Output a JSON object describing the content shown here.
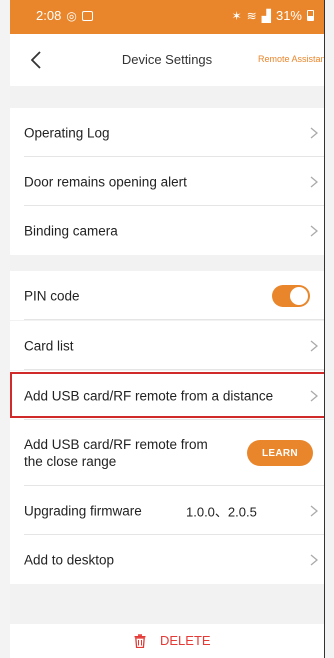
{
  "status_bar": {
    "time": "2:08",
    "battery": "31%"
  },
  "header": {
    "title": "Device Settings",
    "right_action": "Remote Assistance"
  },
  "group1": [
    {
      "label": "Operating Log"
    },
    {
      "label": "Door remains opening alert"
    },
    {
      "label": "Binding camera"
    }
  ],
  "group2": {
    "pin_code": {
      "label": "PIN code",
      "enabled": true
    },
    "card_list": {
      "label": "Card list"
    },
    "add_remote_distance": {
      "label": "Add USB card/RF remote from a distance"
    },
    "add_remote_close": {
      "label": "Add USB card/RF remote from the close range",
      "button": "LEARN"
    },
    "firmware": {
      "label": "Upgrading firmware",
      "version": "1.0.0、2.0.5"
    },
    "add_desktop": {
      "label": "Add to desktop"
    }
  },
  "footer": {
    "delete_label": "DELETE"
  },
  "colors": {
    "accent": "#e9862b",
    "danger": "#e53935",
    "highlight": "#d12a2a"
  }
}
